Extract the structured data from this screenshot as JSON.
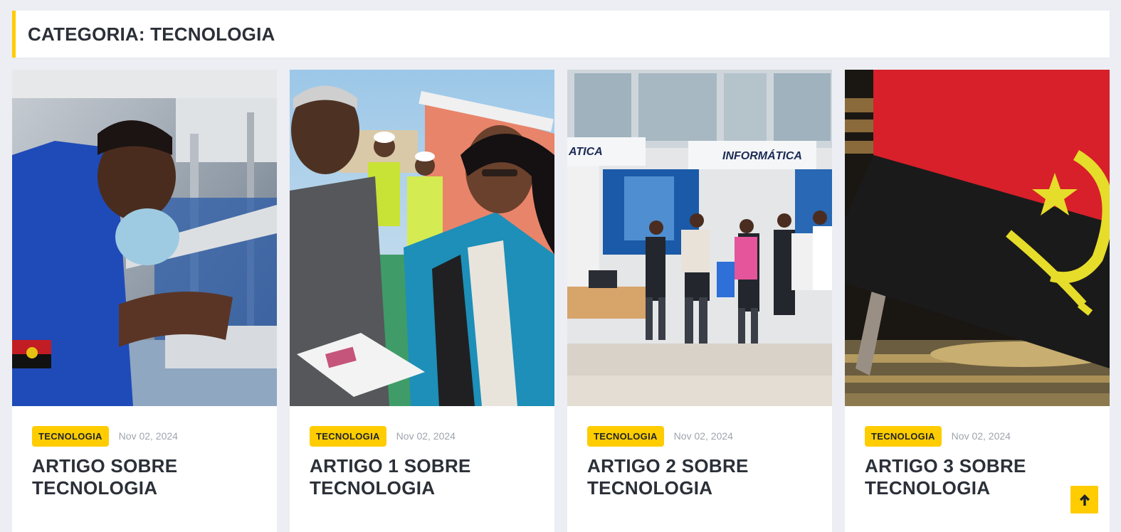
{
  "header": {
    "title": "CATEGORIA: TECNOLOGIA"
  },
  "cards": [
    {
      "category": "TECNOLOGIA",
      "date": "Nov 02, 2024",
      "title": "ARTIGO SOBRE TECNOLOGIA"
    },
    {
      "category": "TECNOLOGIA",
      "date": "Nov 02, 2024",
      "title": "ARTIGO 1 SOBRE TECNOLOGIA"
    },
    {
      "category": "TECNOLOGIA",
      "date": "Nov 02, 2024",
      "title": "ARTIGO 2 SOBRE TECNOLOGIA"
    },
    {
      "category": "TECNOLOGIA",
      "date": "Nov 02, 2024",
      "title": "ARTIGO 3 SOBRE TECNOLOGIA"
    }
  ],
  "images": {
    "booth_sign": "INFORMÁTICA",
    "booth_sign_left": "ATICA"
  },
  "icons": {
    "back_to_top": "arrow-up-icon"
  },
  "colors": {
    "accent": "#ffcc00",
    "background": "#eceef3",
    "text": "#2b3038"
  }
}
